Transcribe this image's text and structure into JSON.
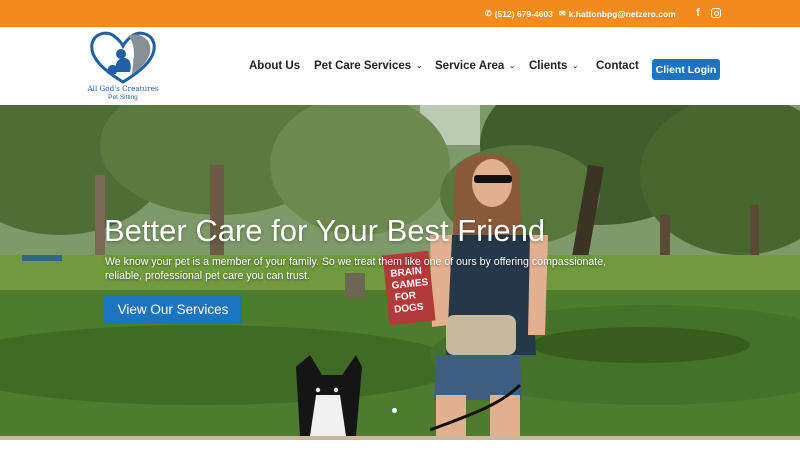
{
  "topbar": {
    "phone": "(512) 679-4603",
    "email": "k.hattonbpg@netzero.com",
    "phone_icon": "phone-icon",
    "email_icon": "envelope-icon",
    "facebook_icon": "facebook-icon",
    "instagram_icon": "instagram-icon",
    "color": "#f48b1f"
  },
  "logo": {
    "brand": "All God's Creatures",
    "tagline": "Pet Sitting"
  },
  "nav": {
    "items": [
      {
        "label": "About Us",
        "has_dropdown": false
      },
      {
        "label": "Pet Care Services",
        "has_dropdown": true
      },
      {
        "label": "Service Area",
        "has_dropdown": true
      },
      {
        "label": "Clients",
        "has_dropdown": true
      },
      {
        "label": "Contact",
        "has_dropdown": false
      }
    ],
    "login_label": "Client Login",
    "accent": "#1b74bf"
  },
  "hero": {
    "headline": "Better Care for Your Best Friend",
    "body": "We know your pet is a member of your family. So we treat them like one of ours by offering compassionate, reliable, professional pet care you can trust.",
    "cta": "View Our Services",
    "book_text": "BRAIN GAMES FOR DOGS"
  }
}
